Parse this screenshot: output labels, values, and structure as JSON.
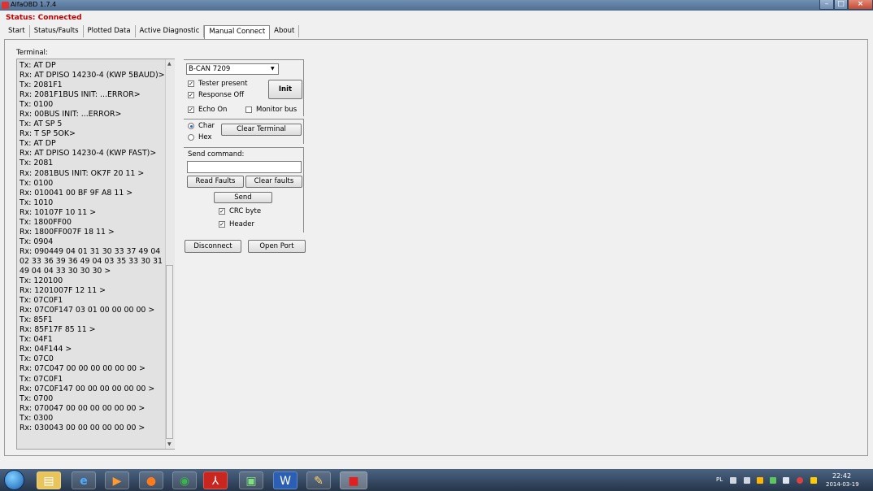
{
  "window": {
    "title": "AlfaOBD 1.7.4"
  },
  "status": "Status: Connected",
  "tabs": [
    "Start",
    "Status/Faults",
    "Plotted Data",
    "Active Diagnostic",
    "Manual Connect",
    "About"
  ],
  "active_tab": "Manual Connect",
  "terminal": {
    "label": "Terminal:",
    "lines": [
      "Tx: AT DP",
      "Rx: AT DPISO 14230-4 (KWP 5BAUD)>",
      "Tx: 2081F1",
      "Rx: 2081F1BUS INIT: ...ERROR>",
      "Tx: 0100",
      "Rx: 00BUS INIT: ...ERROR>",
      "Tx: AT SP 5",
      "Rx: T SP 5OK>",
      "Tx: AT DP",
      "Rx: AT DPISO 14230-4 (KWP FAST)>",
      "Tx: 2081",
      "Rx: 2081BUS INIT: OK7F 20 11 >",
      "Tx: 0100",
      "Rx: 010041 00 BF 9F A8 11 >",
      "Tx: 1010",
      "Rx: 10107F 10 11 >",
      "Tx: 1800FF00",
      "Rx: 1800FF007F 18 11 >",
      "Tx: 0904",
      "Rx: 090449 04 01 31 30 33 37 49 04",
      "02 33 36 39 36 49 04 03 35 33 30 31",
      "49 04 04 33 30 30 30 >",
      "Tx: 120100",
      "Rx: 1201007F 12 11 >",
      "Tx: 07C0F1",
      "Rx: 07C0F147 03 01 00 00 00 00 >",
      "Tx: 85F1",
      "Rx: 85F17F 85 11 >",
      "Tx: 04F1",
      "Rx: 04F144 >",
      "Tx: 07C0",
      "Rx: 07C047 00 00 00 00 00 00 >",
      "Tx: 07C0F1",
      "Rx: 07C0F147 00 00 00 00 00 00 >",
      "Tx: 0700",
      "Rx: 070047 00 00 00 00 00 00 >",
      "Tx: 0300",
      "Rx: 030043 00 00 00 00 00 00 >"
    ]
  },
  "controls": {
    "bus_select": "B-CAN 7209",
    "tester_present": "Tester present",
    "response_off": "Response Off",
    "init_button": "Init",
    "echo_on": "Echo On",
    "monitor_bus": "Monitor bus",
    "char": "Char",
    "hex": "Hex",
    "clear_terminal": "Clear Terminal",
    "send_command_label": "Send command:",
    "send_command_value": "",
    "read_faults": "Read Faults",
    "clear_faults": "Clear faults",
    "send": "Send",
    "crc_byte": "CRC byte",
    "header": "Header",
    "disconnect": "Disconnect",
    "open_port": "Open Port",
    "checked": {
      "tester_present": true,
      "response_off": true,
      "echo_on": true,
      "monitor_bus": false,
      "crc_byte": true,
      "header": true
    },
    "radio_selected": "Char"
  },
  "taskbar": {
    "icons": [
      "start-orb",
      "file-explorer-icon",
      "internet-explorer-icon",
      "media-player-icon",
      "firefox-icon",
      "chrome-icon",
      "acrobat-icon",
      "network-icon",
      "word-icon",
      "paint-icon",
      "alfaobd-car-icon"
    ],
    "language": "PL",
    "time": "22:42",
    "date": "2014-03-19"
  }
}
